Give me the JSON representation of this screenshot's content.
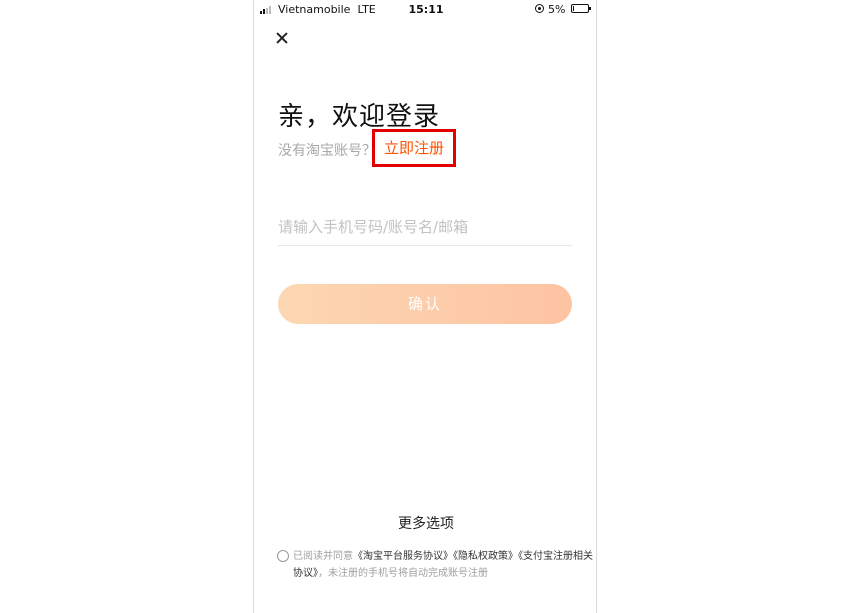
{
  "status_bar": {
    "carrier": "Vietnamobile",
    "network": "LTE",
    "time": "15:11",
    "battery": "5%",
    "battery_level": 0.05
  },
  "login": {
    "title": "亲，欢迎登录",
    "no_account_text": "没有淘宝账号？",
    "register_link": "立即注册",
    "account_placeholder": "请输入手机号码/账号名/邮箱",
    "confirm_button": "确认",
    "more_options": "更多选项"
  },
  "agreement": {
    "prefix": "已阅读并同意",
    "doc_service": "《淘宝平台服务协议》",
    "doc_privacy": "《隐私权政策》",
    "doc_alipay": "《支付宝注册相关协议》",
    "suffix": "，未注册的手机号将自动完成账号注册"
  },
  "colors": {
    "accent": "#ff5000",
    "highlight_box": "#e30000",
    "button_gradient_start": "#fdd7b2",
    "button_gradient_end": "#fdc3a3"
  },
  "icons": {
    "close": "close-icon",
    "signal": "signal-icon",
    "rotation_lock": "rotation-lock-icon",
    "battery": "battery-icon"
  }
}
